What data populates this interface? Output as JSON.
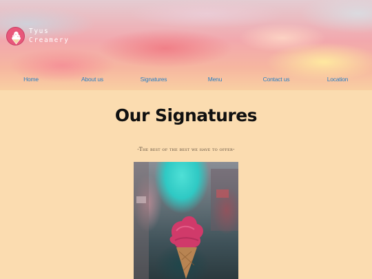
{
  "brand": {
    "name_line1": "Tyus",
    "name_line2": "Creamery",
    "logo_icon": "ice-cream-cone-icon",
    "logo_color": "#e8577a"
  },
  "nav": {
    "items": [
      {
        "label": "Home"
      },
      {
        "label": "About us"
      },
      {
        "label": "Signatures"
      },
      {
        "label": "Menu"
      },
      {
        "label": "Contact us"
      },
      {
        "label": "Location"
      }
    ],
    "link_color": "#2a7fc2"
  },
  "main": {
    "title": "Our Signatures",
    "subtitle": "-The best of the best we have to offer-",
    "background_color": "#fbdcb0"
  }
}
